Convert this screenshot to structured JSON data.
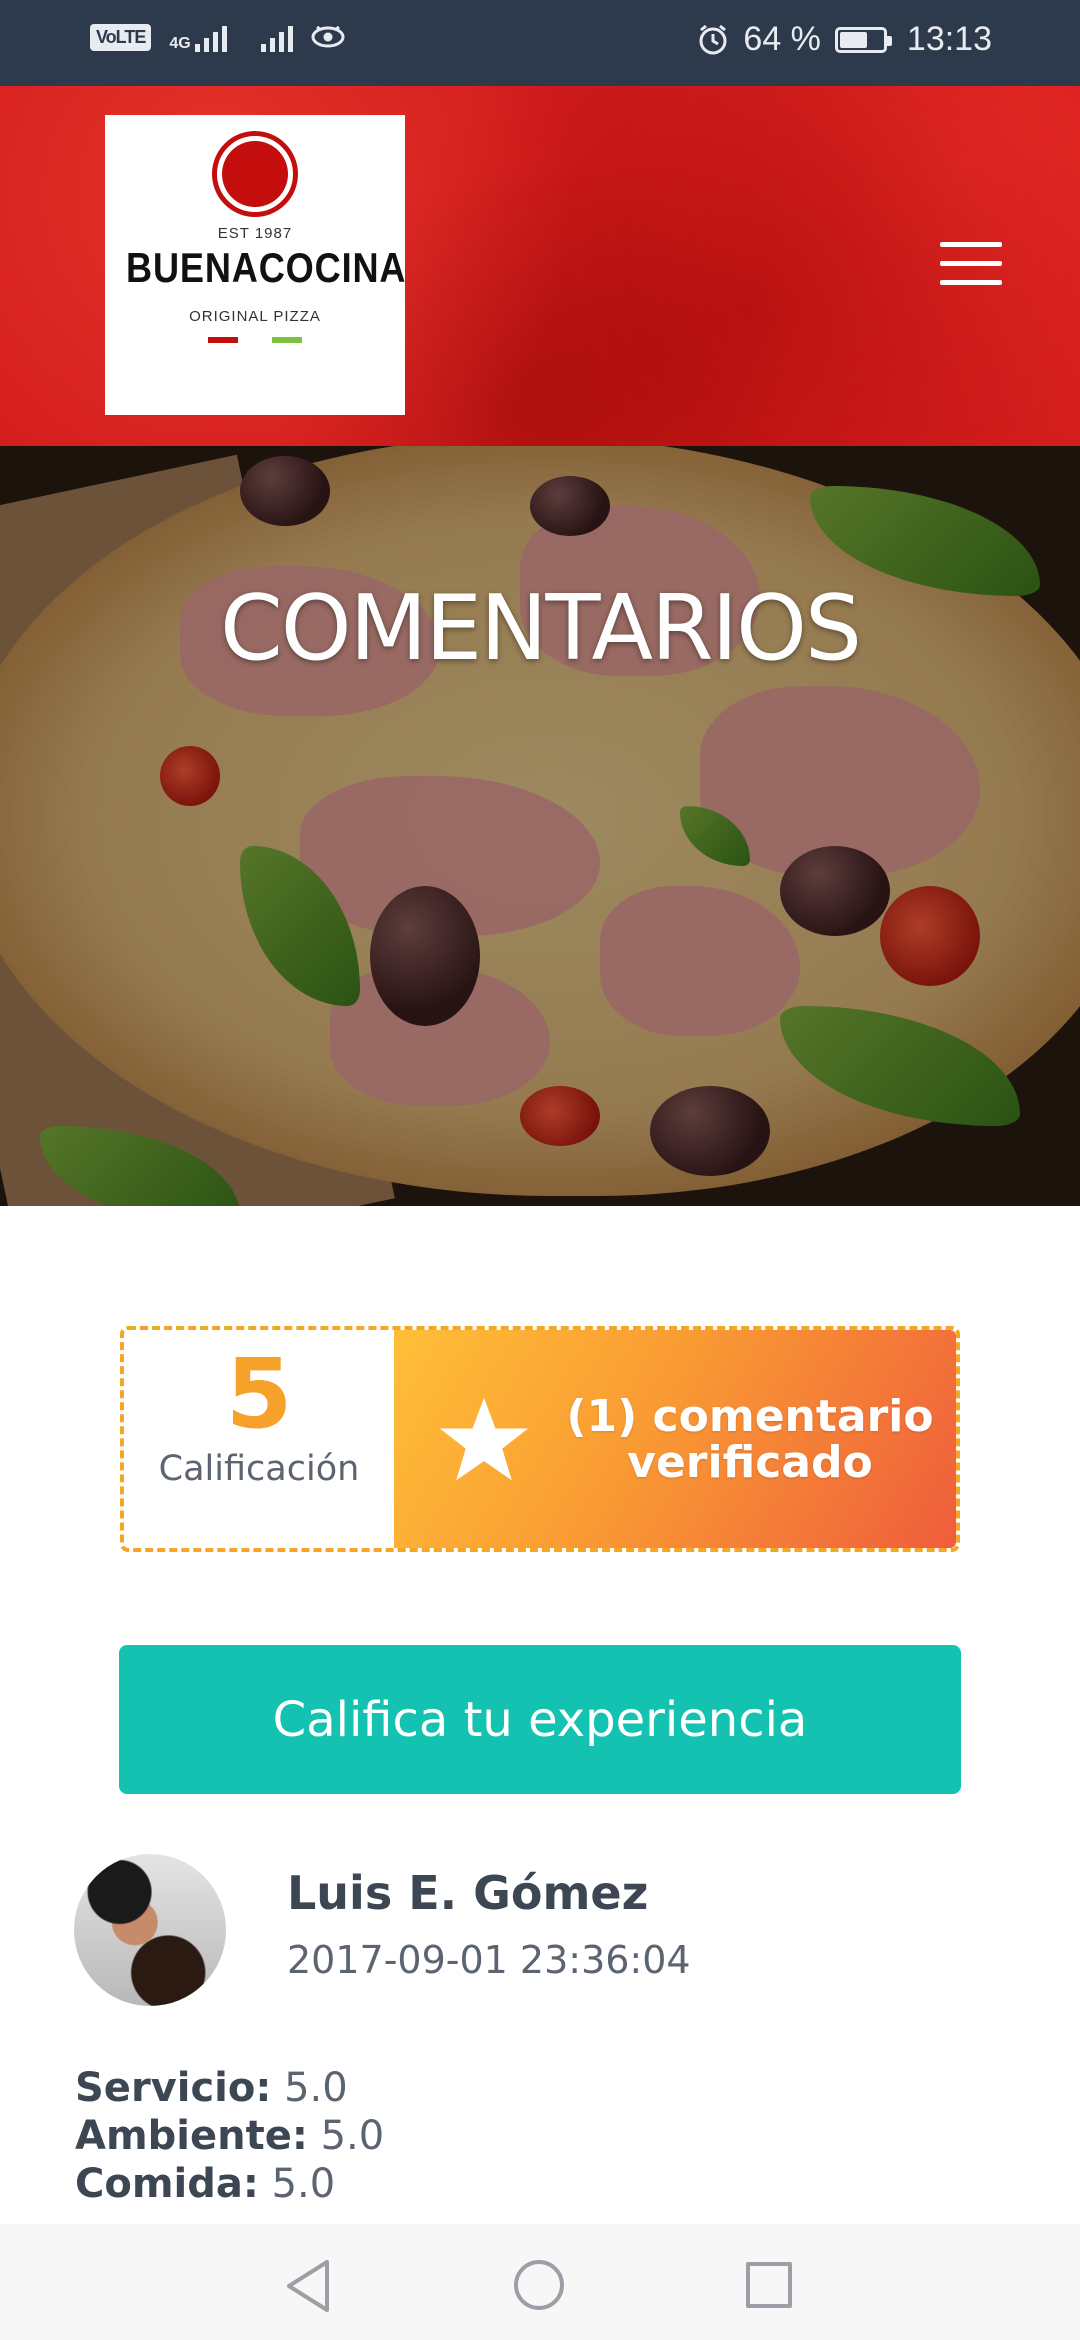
{
  "status_bar": {
    "network_badge": "VoLTE",
    "network_type": "4G",
    "alarm_icon": "alarm-icon",
    "battery_percent": "64 %",
    "battery_level": 0.64,
    "time": "13:13"
  },
  "header": {
    "logo": {
      "est": "EST 1987",
      "name": "BUENACOCINA",
      "tagline": "ORIGINAL PIZZA",
      "colors": {
        "red": "#c40e0e",
        "green": "#7cc242"
      }
    },
    "menu_icon": "hamburger-menu-icon",
    "background_color": "#d21c1c"
  },
  "hero": {
    "title": "COMENTARIOS"
  },
  "rating": {
    "score": "5",
    "score_label": "Calificación",
    "star_icon": "star-icon",
    "summary": "(1) comentario verificado",
    "accent": "#f5a623"
  },
  "cta": {
    "label": "Califica tu experiencia",
    "color": "#13c2b0"
  },
  "review": {
    "name": "Luis E. Gómez",
    "date": "2017-09-01 23:36:04",
    "scores": [
      {
        "label": "Servicio:",
        "value": "5.0"
      },
      {
        "label": "Ambiente:",
        "value": "5.0"
      },
      {
        "label": "Comida:",
        "value": "5.0"
      }
    ]
  },
  "nav_bar": {
    "back_icon": "back-triangle-icon",
    "home_icon": "home-circle-icon",
    "recent_icon": "recent-apps-square-icon"
  }
}
